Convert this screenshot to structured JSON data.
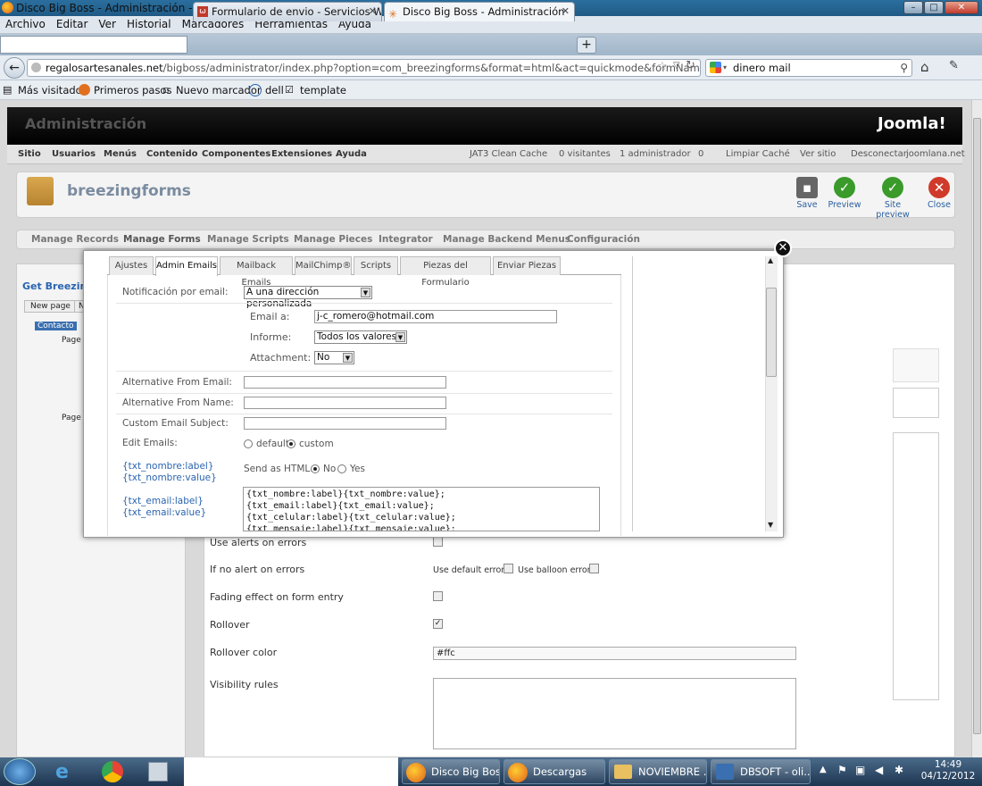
{
  "window": {
    "title": "Disco Big Boss - Administración - Mozilla Firefox"
  },
  "menubar": [
    "Archivo",
    "Editar",
    "Ver",
    "Historial",
    "Marcadores",
    "Herramientas",
    "Ayuda"
  ],
  "tabs": [
    {
      "label": "Formulario de envio - Servicios Web J..."
    },
    {
      "label": "Disco Big Boss - Administración"
    }
  ],
  "nav": {
    "url_host": "regalosartesanales.net",
    "url_path": "/bigboss/administrator/index.php?option=com_breezingforms&format=html&act=quickmode&formName=contacto_disco&f",
    "search_value": "dinero mail"
  },
  "bookmarks": [
    "Más visitados",
    "Primeros pasos",
    "Nuevo marcador",
    "dell",
    "template"
  ],
  "joomla": {
    "admin_title": "Administración",
    "logo": "Joomla!",
    "menu": [
      "Sitio",
      "Usuarios",
      "Menús",
      "Contenido",
      "Componentes",
      "Extensiones",
      "Ayuda"
    ],
    "status": [
      "JAT3 Clean Cache",
      "0 visitantes",
      "1 administrador",
      "0",
      "Limpiar Caché",
      "Ver sitio",
      "Desconectar",
      "joomlana.net"
    ],
    "brand": "breezingforms",
    "toolbar": [
      "Save",
      "Preview",
      "Site preview",
      "Close"
    ],
    "subnav": [
      "Manage Records",
      "Manage Forms",
      "Manage Scripts",
      "Manage Pieces",
      "Integrator",
      "Manage Backend Menus",
      "Configuración"
    ],
    "left": {
      "title": "Get BreezingF",
      "new_page": "New page",
      "n": "N",
      "contacto": "Contacto",
      "page1": "Page",
      "page2": "Page"
    },
    "bg_rows": [
      {
        "label": "Use alerts on errors"
      },
      {
        "label": "If no alert on errors",
        "extra1": "Use default errors",
        "extra2": "Use balloon errors"
      },
      {
        "label": "Fading effect on form entry"
      },
      {
        "label": "Rollover"
      },
      {
        "label": "Rollover color",
        "value": "#ffc"
      },
      {
        "label": "Visibility rules"
      }
    ]
  },
  "modal": {
    "tabs": [
      "Ajustes",
      "Admin Emails",
      "Mailback Emails",
      "MailChimp®",
      "Scripts",
      "Piezas del Formulario",
      "Enviar Piezas"
    ],
    "notif_label": "Notificación por email:",
    "notif_value": "A una dirección personalizada",
    "email_label": "Email a:",
    "email_value": "j-c_romero@hotmail.com",
    "informe_label": "Informe:",
    "informe_value": "Todos los valores",
    "attachment_label": "Attachment:",
    "attachment_value": "No",
    "alt_email_label": "Alternative From Email:",
    "alt_name_label": "Alternative From Name:",
    "subject_label": "Custom Email Subject:",
    "edit_label": "Edit Emails:",
    "edit_default": "default",
    "edit_custom": "custom",
    "html_label": "Send as HTML:",
    "html_no": "No",
    "html_yes": "Yes",
    "ph1": "{txt_nombre:label}",
    "ph2": "{txt_nombre:value}",
    "ph3": "{txt_email:label}",
    "ph4": "{txt_email:value}",
    "code": "{txt_nombre:label}{txt_nombre:value};\n{txt_email:label}{txt_email:value};\n{txt_celular:label}{txt_celular:value};\n{txt_mensaje:label}{txt_mensaje:value};"
  },
  "taskbar": {
    "items": [
      "Disco Big Boss...",
      "Descargas",
      "NOVIEMBRE ...",
      "DBSOFT - oli..."
    ],
    "time": "14:49",
    "date": "04/12/2012"
  }
}
